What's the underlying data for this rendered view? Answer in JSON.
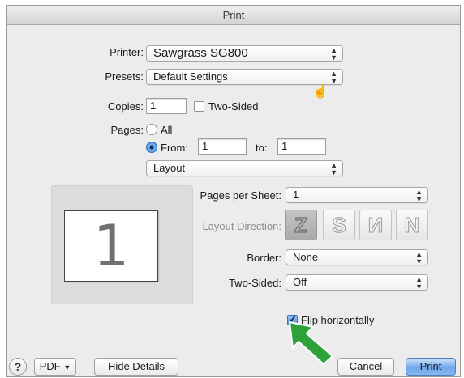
{
  "window": {
    "title": "Print"
  },
  "printer": {
    "label": "Printer:",
    "value": "Sawgrass SG800"
  },
  "presets": {
    "label": "Presets:",
    "value": "Default Settings"
  },
  "copies": {
    "label": "Copies:",
    "value": "1",
    "two_sided_label": "Two-Sided",
    "two_sided_checked": false
  },
  "pages": {
    "label": "Pages:",
    "all_label": "All",
    "from_label": "From:",
    "from_value": "1",
    "to_label": "to:",
    "to_value": "1",
    "selected": "from"
  },
  "section": {
    "value": "Layout"
  },
  "preview": {
    "page_number": "1"
  },
  "layout": {
    "pages_per_sheet_label": "Pages per Sheet:",
    "pages_per_sheet_value": "1",
    "direction_label": "Layout Direction:",
    "direction_options": [
      {
        "name": "z-order-icon",
        "glyph": "Z"
      },
      {
        "name": "s-order-icon",
        "glyph": "S"
      },
      {
        "name": "n-reverse-order-icon",
        "glyph": "И"
      },
      {
        "name": "n-order-icon",
        "glyph": "N"
      }
    ],
    "border_label": "Border:",
    "border_value": "None",
    "two_sided_label": "Two-Sided:",
    "two_sided_value": "Off"
  },
  "flip": {
    "label": "Flip horizontally",
    "checked": true
  },
  "footer": {
    "help": "?",
    "pdf_label": "PDF",
    "hide_details_label": "Hide Details",
    "cancel_label": "Cancel",
    "print_label": "Print"
  },
  "colors": {
    "accent": "#4a8fdc",
    "arrow": "#2ea23a"
  }
}
